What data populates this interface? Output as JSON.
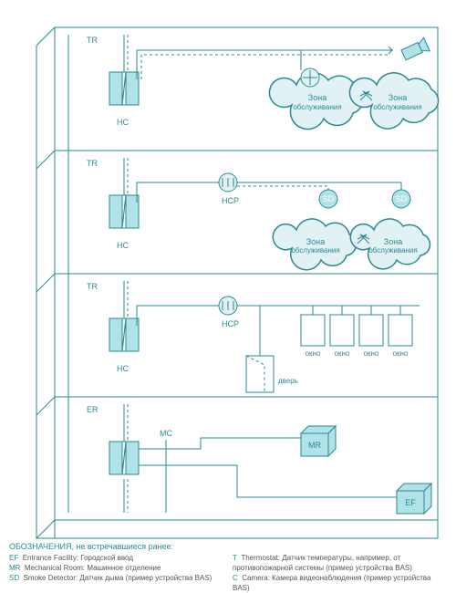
{
  "labels": {
    "TR": "TR",
    "ER": "ER",
    "HC": "HC",
    "MC": "MC",
    "HCP": "HCP",
    "SD": "SD",
    "T": "T",
    "MR": "MR",
    "EF": "EF",
    "okno": "okно",
    "door": "дверь",
    "zona": "Зона",
    "obsluzh": "обслуживания"
  },
  "legend": {
    "heading": "ОБОЗНАЧЕНИЯ, не встречавшиеся ранее:",
    "col1": [
      {
        "code": "EF",
        "text": "Entrance Facility: Городской ввод"
      },
      {
        "code": "MR",
        "text": "Mechanical Room: Машинное отделение"
      },
      {
        "code": "SD",
        "text": "Smoke Detector: Датчик дыма (пример устройства BAS)"
      }
    ],
    "col2": [
      {
        "code": "T",
        "text": "Thermostat: Датчик температуры, например, от противопожарной системы (пример устройства BAS)"
      },
      {
        "code": "C",
        "text": "Camera: Камера видеонаблюдения (пример устройства BAS)"
      }
    ]
  },
  "windows": [
    "окно",
    "окно",
    "окно",
    "окно"
  ],
  "colors": {
    "teal": "#2a8a92",
    "light": "#e2f2f4",
    "fill": "#b0e2e8"
  }
}
